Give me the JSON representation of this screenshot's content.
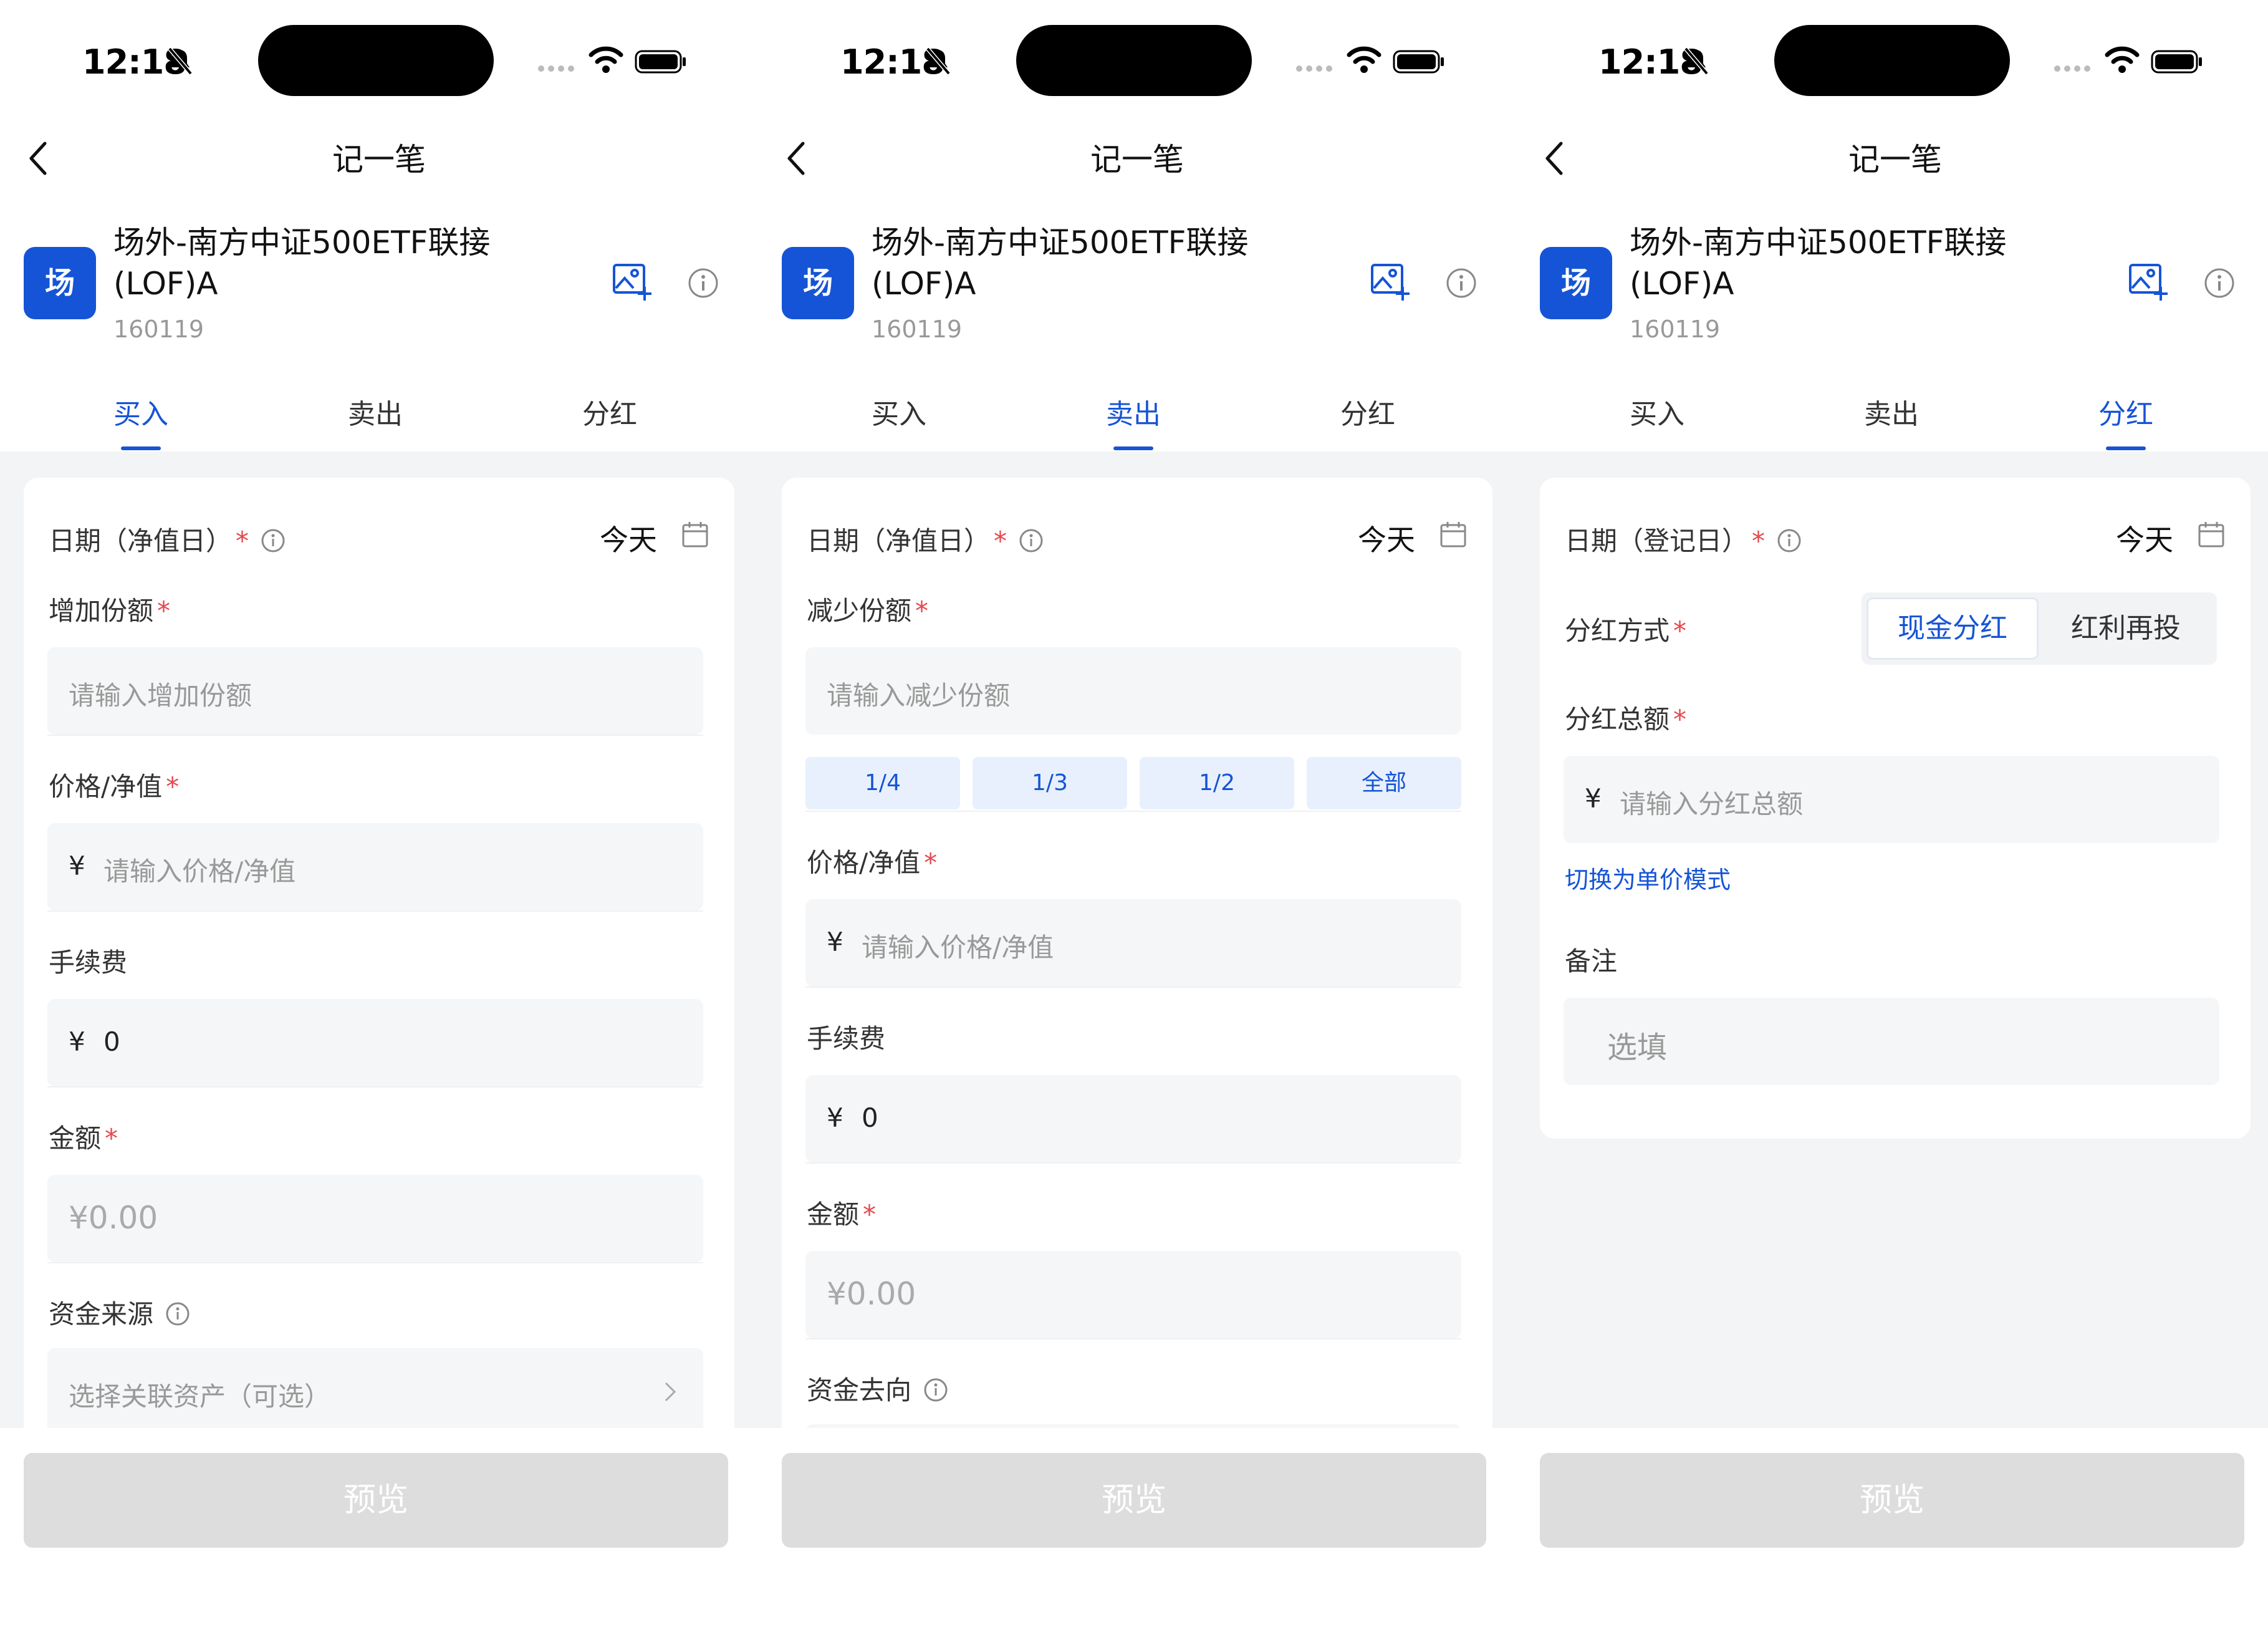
{
  "status_bar": {
    "time": "12:18"
  },
  "nav": {
    "title": "记一笔"
  },
  "fund": {
    "logo_text": "场",
    "name_line1": "场外-南方中证500ETF联接",
    "name_line2": "(LOF)A",
    "code": "160119"
  },
  "tabs": [
    "买入",
    "卖出",
    "分红"
  ],
  "screens": [
    {
      "active_tab": 0,
      "date_label": "日期（净值日）",
      "date_value": "今天",
      "shares_label": "增加份额",
      "shares_placeholder": "请输入增加份额",
      "price_label": "价格/净值",
      "price_placeholder": "请输入价格/净值",
      "fee_label": "手续费",
      "fee_value": "0",
      "amount_label": "金额",
      "amount_value": "¥0.00",
      "source_label": "资金来源",
      "source_placeholder": "选择关联资产（可选）",
      "preview_label": "预览"
    },
    {
      "active_tab": 1,
      "date_label": "日期（净值日）",
      "date_value": "今天",
      "shares_label": "减少份额",
      "shares_placeholder": "请输入减少份额",
      "quick_options": [
        "1/4",
        "1/3",
        "1/2",
        "全部"
      ],
      "price_label": "价格/净值",
      "price_placeholder": "请输入价格/净值",
      "fee_label": "手续费",
      "fee_value": "0",
      "amount_label": "金额",
      "amount_value": "¥0.00",
      "dest_label": "资金去向",
      "preview_label": "预览"
    },
    {
      "active_tab": 2,
      "date_label": "日期（登记日）",
      "date_value": "今天",
      "method_label": "分红方式",
      "method_options": [
        "现金分红",
        "红利再投"
      ],
      "method_selected": 0,
      "total_label": "分红总额",
      "total_placeholder": "请输入分红总额",
      "switch_link": "切换为单价模式",
      "note_label": "备注",
      "note_placeholder": "选填",
      "preview_label": "预览"
    }
  ],
  "currency_symbol": "¥",
  "required_mark": "*",
  "colors": {
    "accent": "#1554d6",
    "required": "#e5484d",
    "background": "#f3f4f6",
    "disabled_button": "#dddddd"
  }
}
